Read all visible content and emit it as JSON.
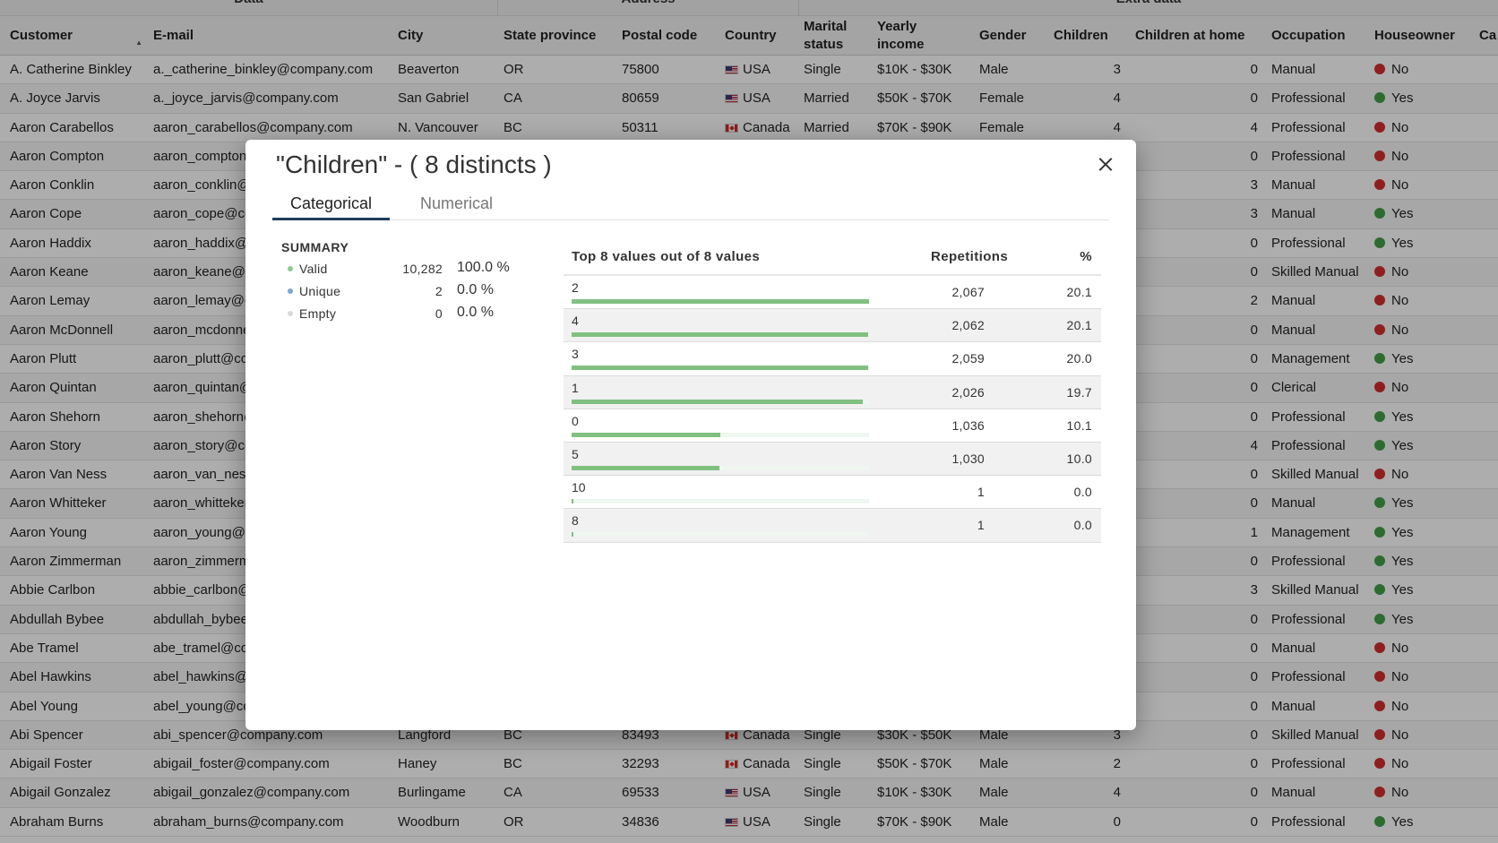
{
  "grid": {
    "groups": [
      "Data",
      "Address",
      "Extra data"
    ],
    "headers": {
      "customer": "Customer",
      "email": "E-mail",
      "city": "City",
      "state": "State province",
      "postal": "Postal code",
      "country": "Country",
      "marital": "Marital status",
      "income": "Yearly income",
      "gender": "Gender",
      "children": "Children",
      "children_home": "Children at home",
      "occupation": "Occupation",
      "houseowner": "Houseowner",
      "cars": "Ca"
    },
    "rows": [
      {
        "customer": "A. Catherine Binkley",
        "email": "a._catherine_binkley@company.com",
        "city": "Beaverton",
        "state": "OR",
        "postal": "75800",
        "country": "USA",
        "marital": "Single",
        "income": "$10K - $30K",
        "gender": "Male",
        "children": "3",
        "children_home": "0",
        "occupation": "Manual",
        "houseowner": "No"
      },
      {
        "customer": "A. Joyce Jarvis",
        "email": "a._joyce_jarvis@company.com",
        "city": "San Gabriel",
        "state": "CA",
        "postal": "80659",
        "country": "USA",
        "marital": "Married",
        "income": "$50K - $70K",
        "gender": "Female",
        "children": "4",
        "children_home": "0",
        "occupation": "Professional",
        "houseowner": "Yes"
      },
      {
        "customer": "Aaron Carabellos",
        "email": "aaron_carabellos@company.com",
        "city": "N. Vancouver",
        "state": "BC",
        "postal": "50311",
        "country": "Canada",
        "marital": "Married",
        "income": "$70K - $90K",
        "gender": "Female",
        "children": "4",
        "children_home": "4",
        "occupation": "Professional",
        "houseowner": "No"
      },
      {
        "customer": "Aaron Compton",
        "email": "aaron_compton@company.com",
        "city": "",
        "state": "",
        "postal": "",
        "country": "",
        "marital": "",
        "income": "",
        "gender": "",
        "children": "",
        "children_home": "0",
        "occupation": "Professional",
        "houseowner": "No"
      },
      {
        "customer": "Aaron Conklin",
        "email": "aaron_conklin@company.com",
        "city": "",
        "state": "",
        "postal": "",
        "country": "",
        "marital": "",
        "income": "",
        "gender": "",
        "children": "",
        "children_home": "3",
        "occupation": "Manual",
        "houseowner": "No"
      },
      {
        "customer": "Aaron Cope",
        "email": "aaron_cope@company.com",
        "city": "",
        "state": "",
        "postal": "",
        "country": "",
        "marital": "",
        "income": "",
        "gender": "",
        "children": "",
        "children_home": "3",
        "occupation": "Manual",
        "houseowner": "Yes"
      },
      {
        "customer": "Aaron Haddix",
        "email": "aaron_haddix@company.com",
        "city": "",
        "state": "",
        "postal": "",
        "country": "",
        "marital": "",
        "income": "",
        "gender": "",
        "children": "",
        "children_home": "0",
        "occupation": "Professional",
        "houseowner": "Yes"
      },
      {
        "customer": "Aaron Keane",
        "email": "aaron_keane@company.com",
        "city": "",
        "state": "",
        "postal": "",
        "country": "",
        "marital": "",
        "income": "",
        "gender": "",
        "children": "",
        "children_home": "0",
        "occupation": "Skilled Manual",
        "houseowner": "No"
      },
      {
        "customer": "Aaron Lemay",
        "email": "aaron_lemay@company.com",
        "city": "",
        "state": "",
        "postal": "",
        "country": "",
        "marital": "",
        "income": "",
        "gender": "",
        "children": "",
        "children_home": "2",
        "occupation": "Manual",
        "houseowner": "No"
      },
      {
        "customer": "Aaron McDonnell",
        "email": "aaron_mcdonnell@company.com",
        "city": "",
        "state": "",
        "postal": "",
        "country": "",
        "marital": "",
        "income": "",
        "gender": "",
        "children": "",
        "children_home": "0",
        "occupation": "Manual",
        "houseowner": "No"
      },
      {
        "customer": "Aaron Plutt",
        "email": "aaron_plutt@company.com",
        "city": "",
        "state": "",
        "postal": "",
        "country": "",
        "marital": "",
        "income": "",
        "gender": "",
        "children": "",
        "children_home": "0",
        "occupation": "Management",
        "houseowner": "Yes"
      },
      {
        "customer": "Aaron Quintan",
        "email": "aaron_quintan@company.com",
        "city": "",
        "state": "",
        "postal": "",
        "country": "",
        "marital": "",
        "income": "",
        "gender": "",
        "children": "",
        "children_home": "0",
        "occupation": "Clerical",
        "houseowner": "No"
      },
      {
        "customer": "Aaron Shehorn",
        "email": "aaron_shehorn@company.com",
        "city": "",
        "state": "",
        "postal": "",
        "country": "",
        "marital": "",
        "income": "",
        "gender": "",
        "children": "",
        "children_home": "0",
        "occupation": "Professional",
        "houseowner": "Yes"
      },
      {
        "customer": "Aaron Story",
        "email": "aaron_story@company.com",
        "city": "",
        "state": "",
        "postal": "",
        "country": "",
        "marital": "",
        "income": "",
        "gender": "",
        "children": "",
        "children_home": "4",
        "occupation": "Professional",
        "houseowner": "Yes"
      },
      {
        "customer": "Aaron Van Ness",
        "email": "aaron_van_ness@company.com",
        "city": "",
        "state": "",
        "postal": "",
        "country": "",
        "marital": "",
        "income": "",
        "gender": "",
        "children": "",
        "children_home": "0",
        "occupation": "Skilled Manual",
        "houseowner": "No"
      },
      {
        "customer": "Aaron Whitteker",
        "email": "aaron_whitteker@company.com",
        "city": "",
        "state": "",
        "postal": "",
        "country": "",
        "marital": "",
        "income": "",
        "gender": "",
        "children": "",
        "children_home": "0",
        "occupation": "Manual",
        "houseowner": "Yes"
      },
      {
        "customer": "Aaron Young",
        "email": "aaron_young@company.com",
        "city": "",
        "state": "",
        "postal": "",
        "country": "",
        "marital": "",
        "income": "",
        "gender": "",
        "children": "",
        "children_home": "1",
        "occupation": "Management",
        "houseowner": "Yes"
      },
      {
        "customer": "Aaron Zimmerman",
        "email": "aaron_zimmerman@company.com",
        "city": "",
        "state": "",
        "postal": "",
        "country": "",
        "marital": "",
        "income": "",
        "gender": "",
        "children": "",
        "children_home": "0",
        "occupation": "Professional",
        "houseowner": "Yes"
      },
      {
        "customer": "Abbie Carlbon",
        "email": "abbie_carlbon@company.com",
        "city": "",
        "state": "",
        "postal": "",
        "country": "",
        "marital": "",
        "income": "",
        "gender": "",
        "children": "",
        "children_home": "3",
        "occupation": "Skilled Manual",
        "houseowner": "Yes"
      },
      {
        "customer": "Abdullah Bybee",
        "email": "abdullah_bybee@company.com",
        "city": "",
        "state": "",
        "postal": "",
        "country": "",
        "marital": "",
        "income": "",
        "gender": "",
        "children": "",
        "children_home": "0",
        "occupation": "Professional",
        "houseowner": "Yes"
      },
      {
        "customer": "Abe Tramel",
        "email": "abe_tramel@company.com",
        "city": "",
        "state": "",
        "postal": "",
        "country": "",
        "marital": "",
        "income": "",
        "gender": "",
        "children": "",
        "children_home": "0",
        "occupation": "Manual",
        "houseowner": "No"
      },
      {
        "customer": "Abel Hawkins",
        "email": "abel_hawkins@company.com",
        "city": "",
        "state": "",
        "postal": "",
        "country": "",
        "marital": "",
        "income": "",
        "gender": "",
        "children": "",
        "children_home": "0",
        "occupation": "Professional",
        "houseowner": "No"
      },
      {
        "customer": "Abel Young",
        "email": "abel_young@company.com",
        "city": "",
        "state": "",
        "postal": "",
        "country": "",
        "marital": "",
        "income": "",
        "gender": "",
        "children": "",
        "children_home": "0",
        "occupation": "Manual",
        "houseowner": "No"
      },
      {
        "customer": "Abi Spencer",
        "email": "abi_spencer@company.com",
        "city": "Langford",
        "state": "BC",
        "postal": "83493",
        "country": "Canada",
        "marital": "Single",
        "income": "$30K - $50K",
        "gender": "Male",
        "children": "3",
        "children_home": "0",
        "occupation": "Skilled Manual",
        "houseowner": "No"
      },
      {
        "customer": "Abigail Foster",
        "email": "abigail_foster@company.com",
        "city": "Haney",
        "state": "BC",
        "postal": "32293",
        "country": "Canada",
        "marital": "Single",
        "income": "$50K - $70K",
        "gender": "Male",
        "children": "2",
        "children_home": "0",
        "occupation": "Professional",
        "houseowner": "No"
      },
      {
        "customer": "Abigail Gonzalez",
        "email": "abigail_gonzalez@company.com",
        "city": "Burlingame",
        "state": "CA",
        "postal": "69533",
        "country": "USA",
        "marital": "Single",
        "income": "$10K - $30K",
        "gender": "Male",
        "children": "4",
        "children_home": "0",
        "occupation": "Manual",
        "houseowner": "No"
      },
      {
        "customer": "Abraham Burns",
        "email": "abraham_burns@company.com",
        "city": "Woodburn",
        "state": "OR",
        "postal": "34836",
        "country": "USA",
        "marital": "Single",
        "income": "$70K - $90K",
        "gender": "Male",
        "children": "0",
        "children_home": "0",
        "occupation": "Professional",
        "houseowner": "Yes"
      }
    ]
  },
  "modal": {
    "title": "\"Children\" - ( 8 distincts )",
    "tabs": [
      "Categorical",
      "Numerical"
    ],
    "summary": {
      "title": "SUMMARY",
      "items": [
        {
          "label": "Valid",
          "count": "10,282",
          "pct": "100.0 %",
          "color": "#8fc98f"
        },
        {
          "label": "Unique",
          "count": "2",
          "pct": "0.0 %",
          "color": "#7aa7d8"
        },
        {
          "label": "Empty",
          "count": "0",
          "pct": "0.0 %",
          "color": "#d9d9d9"
        }
      ]
    },
    "table": {
      "header_values": "Top 8 values out of 8 values",
      "header_repetitions": "Repetitions",
      "header_pct": "%",
      "rows": [
        {
          "value": "2",
          "repetitions": "2,067",
          "pct": "20.1",
          "fill": 1.0
        },
        {
          "value": "4",
          "repetitions": "2,062",
          "pct": "20.1",
          "fill": 0.998
        },
        {
          "value": "3",
          "repetitions": "2,059",
          "pct": "20.0",
          "fill": 0.996
        },
        {
          "value": "1",
          "repetitions": "2,026",
          "pct": "19.7",
          "fill": 0.98
        },
        {
          "value": "0",
          "repetitions": "1,036",
          "pct": "10.1",
          "fill": 0.501
        },
        {
          "value": "5",
          "repetitions": "1,030",
          "pct": "10.0",
          "fill": 0.498
        },
        {
          "value": "10",
          "repetitions": "1",
          "pct": "0.0",
          "fill": 0.005
        },
        {
          "value": "8",
          "repetitions": "1",
          "pct": "0.0",
          "fill": 0.005
        }
      ]
    }
  }
}
